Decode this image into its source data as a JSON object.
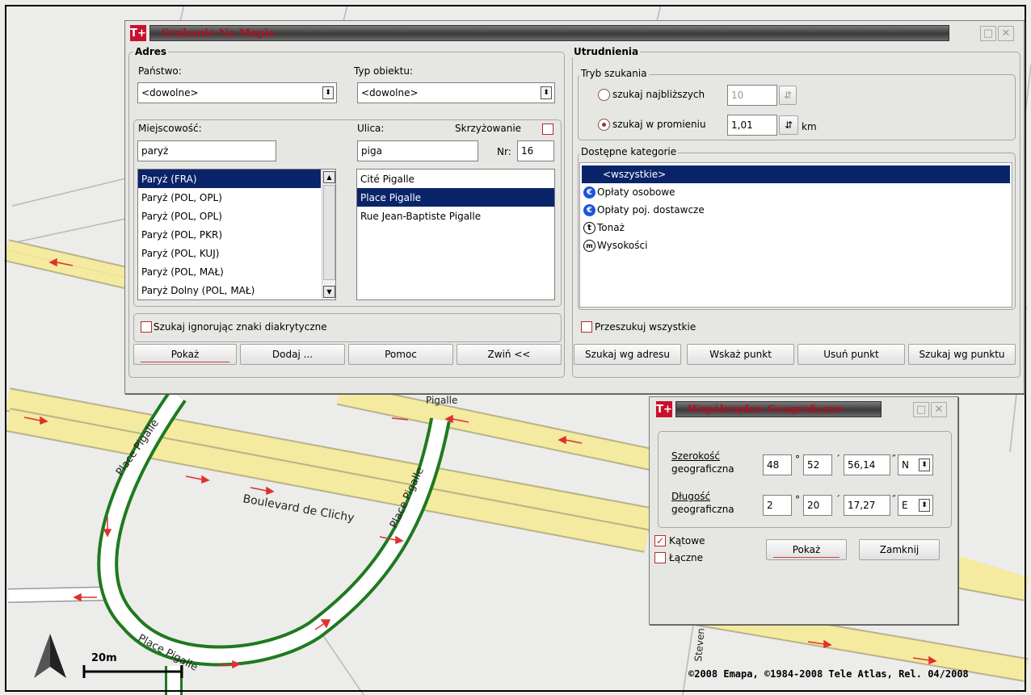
{
  "map": {
    "street_labels": {
      "boulevard": "Boulevard de Clichy",
      "place_top": "Place Pigalle",
      "place_right": "Place Pigalle",
      "place_bottom": "Place Pigalle",
      "pigalle": "Pigalle",
      "steven": "Steven"
    },
    "scale_label": "20m",
    "copyright": "©2008 Emapa, ©1984-2008 Tele Atlas, Rel. 04/2008",
    "colors": {
      "road_yellow": "#f4eaa0",
      "road_green": "#1e7a1e",
      "background": "#ececea",
      "arrow": "#e03030"
    }
  },
  "search_window": {
    "logo": "T+",
    "title": "Szukanie Na Mapie",
    "adres": {
      "group_label": "Adres",
      "panstwo_label": "Państwo:",
      "panstwo_value": "<dowolne>",
      "typ_label": "Typ obiektu:",
      "typ_value": "<dowolne>",
      "miejscowosc_label": "Miejscowość:",
      "miejscowosc_value": "paryż",
      "ulica_label": "Ulica:",
      "ulica_value": "piga",
      "skrzyzowanie_label": "Skrzyżowanie",
      "nr_label": "Nr:",
      "nr_value": "16",
      "cities": [
        "Paryż (FRA)",
        "Paryż (POL, OPL)",
        "Paryż (POL, OPL)",
        "Paryż (POL, PKR)",
        "Paryż (POL, KUJ)",
        "Paryż (POL, MAŁ)",
        "Paryż Dolny (POL, MAŁ)"
      ],
      "streets": [
        "Cité Pigalle",
        "Place Pigalle",
        "Rue Jean-Baptiste Pigalle"
      ],
      "ignore_diacritics_label": "Szukaj ignorując znaki diakrytyczne",
      "buttons": {
        "pokaz": "Pokaż",
        "dodaj": "Dodaj ...",
        "pomoc": "Pomoc",
        "zwin": "Zwiń <<"
      }
    },
    "utrudnienia": {
      "group_label": "Utrudnienia",
      "tryb_label": "Tryb szukania",
      "najblizszych_label": "szukaj najbliższych",
      "najblizszych_value": "10",
      "promieniu_label": "szukaj w promieniu",
      "promieniu_value": "1,01",
      "km_label": "km",
      "kategorie_label": "Dostępne kategorie",
      "categories": {
        "all": "<wszystkie>",
        "osobowe": "Opłaty osobowe",
        "dostawcze": "Opłaty poj. dostawcze",
        "tonaz": "Tonaż",
        "wysokosci": "Wysokości"
      },
      "przeszukuj_label": "Przeszukuj wszystkie",
      "buttons": {
        "szukaj_adres": "Szukaj wg adresu",
        "wskaz": "Wskaż punkt",
        "usun": "Usuń punkt",
        "szukaj_punkt": "Szukaj wg punktu"
      }
    }
  },
  "coords_window": {
    "logo": "T+",
    "title": "Współrzędne Geograficzne",
    "lat_label_1": "Szerokość",
    "lat_label_2": "geograficzna",
    "lat_deg": "48",
    "lat_min": "52",
    "lat_sec": "56,14",
    "lat_dir": "N",
    "lon_label_1": "Długość",
    "lon_label_2": "geograficzna",
    "lon_deg": "2",
    "lon_min": "20",
    "lon_sec": "17,27",
    "lon_dir": "E",
    "deg_sym": "°",
    "min_sym": "´",
    "sec_sym": "˝",
    "katowe_label": "Kątowe",
    "laczne_label": "Łączne",
    "pokaz": "Pokaż",
    "zamknij": "Zamknij"
  }
}
